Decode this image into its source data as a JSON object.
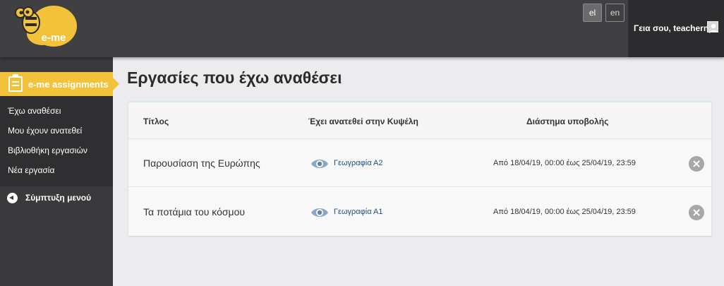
{
  "colors": {
    "topbar": "#404042",
    "sidebar": "#3a3a3c",
    "accent": "#f2c23a",
    "link": "#1f4f7a"
  },
  "header": {
    "logo_text": "e-me",
    "languages": [
      {
        "code": "el",
        "active": true
      },
      {
        "code": "en",
        "active": false
      }
    ],
    "greeting": "Γεια σου, teachernp"
  },
  "sidebar": {
    "title": "e-me assignments",
    "items": [
      {
        "label": "Έχω αναθέσει"
      },
      {
        "label": "Μου έχουν ανατεθεί"
      },
      {
        "label": "Βιβλιοθήκη εργασιών"
      },
      {
        "label": "Νέα εργασία"
      }
    ],
    "collapse_label": "Σύμπτυξη μενού"
  },
  "main": {
    "title": "Εργασίες που έχω αναθέσει",
    "columns": [
      "Τίτλος",
      "Έχει ανατεθεί στην Κυψέλη",
      "Διάστημα υποβολής"
    ],
    "rows": [
      {
        "title": "Παρουσίαση της Ευρώπης",
        "class": "Γεωγραφία Α2",
        "period": "Από 18/04/19, 00:00 έως 25/04/19, 23:59"
      },
      {
        "title": "Τα ποτάμια του κόσμου",
        "class": "Γεωγραφία Α1",
        "period": "Από 18/04/19, 00:00 έως 25/04/19, 23:59"
      }
    ]
  }
}
